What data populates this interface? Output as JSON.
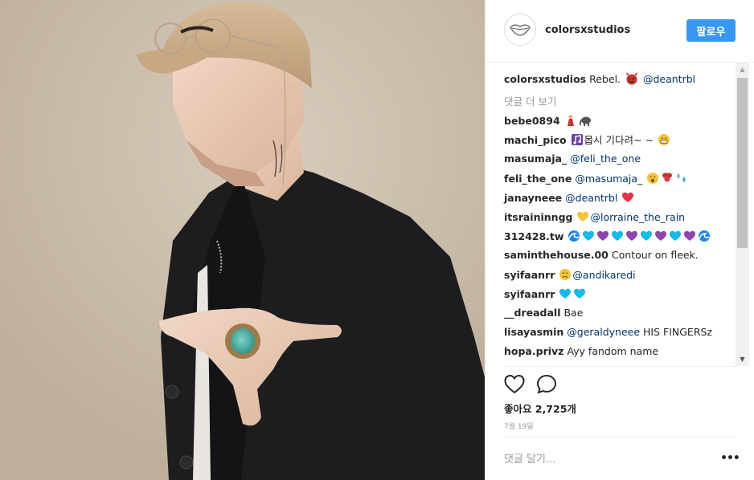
{
  "post": {
    "account": "colorsxstudios",
    "follow_label": "팔로우",
    "caption": {
      "user": "colorsxstudios",
      "text": "Rebel.",
      "emoji": "devil-emoji",
      "mention": "@deantrbl"
    },
    "view_more_label": "댓글 더 보기",
    "comments": [
      {
        "user": "bebe0894",
        "parts": [
          {
            "emoji": "woman-emoji",
            "color": "#c0392b"
          },
          {
            "emoji": "elephant-emoji",
            "color": "#555"
          }
        ]
      },
      {
        "user": "machi_pico",
        "parts": [
          {
            "emoji": "music-note-emoji",
            "color": "#6b3fa0"
          },
          {
            "text": "몹시 기다려~ ~"
          },
          {
            "emoji": "grin-emoji",
            "color": "#f5c33b"
          }
        ]
      },
      {
        "user": "masumaja_",
        "parts": [
          {
            "mention": "@feli_the_one"
          }
        ]
      },
      {
        "user": "feli_the_one",
        "parts": [
          {
            "mention": "@masumaja_"
          },
          {
            "emoji": "shocked-emoji",
            "color": "#f5c33b"
          },
          {
            "emoji": "tongue-emoji",
            "color": "#e0334a"
          },
          {
            "emoji": "sweat-drops-emoji",
            "color": "#3fa9f5"
          }
        ]
      },
      {
        "user": "janayneee",
        "parts": [
          {
            "mention": "@deantrbl"
          },
          {
            "emoji": "heart-emoji",
            "color": "#e0334a"
          }
        ]
      },
      {
        "user": "itsraininngg",
        "parts": [
          {
            "emoji": "heart-eyes-emoji",
            "color": "#f5c33b"
          },
          {
            "mention": "@lorraine_the_rain"
          }
        ]
      },
      {
        "user": "312428.tw",
        "parts": [
          {
            "emoji": "wave-emoji",
            "color": "#1e88e5"
          },
          {
            "emoji": "blue-heart-emoji",
            "color": "#18b8e8"
          },
          {
            "emoji": "purple-heart-emoji",
            "color": "#8e44ad"
          },
          {
            "emoji": "blue-heart-emoji",
            "color": "#18b8e8"
          },
          {
            "emoji": "purple-heart-emoji",
            "color": "#8e44ad"
          },
          {
            "emoji": "blue-heart-emoji",
            "color": "#18b8e8"
          },
          {
            "emoji": "purple-heart-emoji",
            "color": "#8e44ad"
          },
          {
            "emoji": "blue-heart-emoji",
            "color": "#18b8e8"
          },
          {
            "emoji": "purple-heart-emoji",
            "color": "#8e44ad"
          },
          {
            "emoji": "wave-emoji",
            "color": "#1e88e5"
          }
        ]
      },
      {
        "user": "saminthehouse.00",
        "parts": [
          {
            "text": "Contour on fleek."
          }
        ]
      },
      {
        "user": "syifaanrr",
        "parts": [
          {
            "emoji": "sad-face-emoji",
            "color": "#f5c33b"
          },
          {
            "mention": "@andikaredi"
          }
        ]
      },
      {
        "user": "syifaanrr",
        "parts": [
          {
            "emoji": "blue-heart-emoji",
            "color": "#18b8e8"
          },
          {
            "emoji": "blue-heart-emoji",
            "color": "#18b8e8"
          }
        ]
      },
      {
        "user": "__dreadall",
        "parts": [
          {
            "text": "Bae"
          }
        ]
      },
      {
        "user": "lisayasmin",
        "parts": [
          {
            "mention": "@geraldyneee"
          },
          {
            "text": "HIS FINGERSz"
          }
        ]
      },
      {
        "user": "hopa.privz",
        "parts": [
          {
            "text": "Ayy fandom name"
          }
        ]
      }
    ],
    "likes_label": "좋아요 2,725개",
    "date_label": "7월 19일",
    "comment_placeholder": "댓글 달기...",
    "more_options_label": "•••",
    "icons": {
      "like": "heart-outline-icon",
      "comment": "speech-bubble-icon",
      "options": "more-options-icon",
      "avatar": "lips-logo-icon"
    },
    "colors": {
      "accent": "#3897f0",
      "mention": "#003569",
      "muted": "#999999",
      "border": "#efefef"
    }
  }
}
